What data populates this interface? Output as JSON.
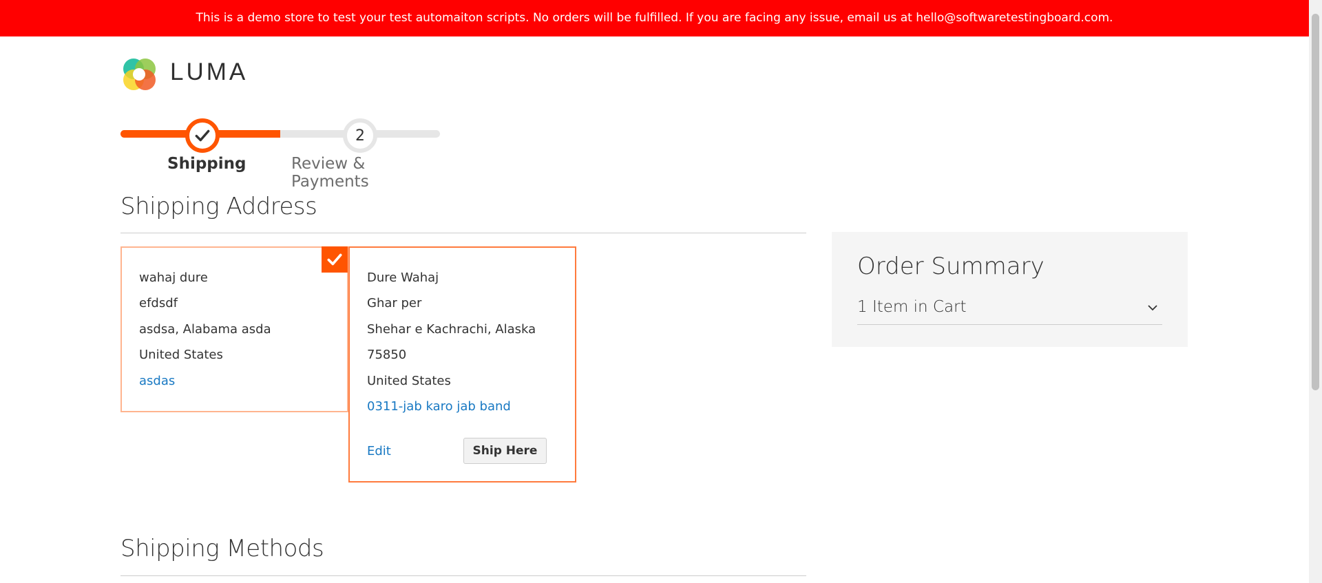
{
  "notice": {
    "text": "This is a demo store to test your test automaiton scripts. No orders will be fulfilled. If you are facing any issue, email us at hello@softwaretestingboard.com."
  },
  "header": {
    "logo_text": "LUMA"
  },
  "progress": {
    "steps": [
      {
        "label": "Shipping",
        "state": "complete"
      },
      {
        "label": "Review & Payments",
        "number": "2",
        "state": "pending"
      }
    ],
    "accent_color": "#ff5501"
  },
  "shipping": {
    "title": "Shipping Address",
    "addresses": [
      {
        "selected": true,
        "lines": [
          "wahaj dure",
          "efdsdf",
          "asdsa, Alabama asda",
          "United States"
        ],
        "phone": "asdas"
      },
      {
        "selected": false,
        "lines": [
          "Dure Wahaj",
          "Ghar per",
          "Shehar e Kachrachi, Alaska",
          "75850",
          "United States"
        ],
        "phone": "0311-jab karo jab band",
        "edit_label": "Edit",
        "ship_label": "Ship Here"
      }
    ]
  },
  "methods": {
    "title": "Shipping Methods"
  },
  "summary": {
    "title": "Order Summary",
    "items_label": "1 Item in Cart"
  }
}
